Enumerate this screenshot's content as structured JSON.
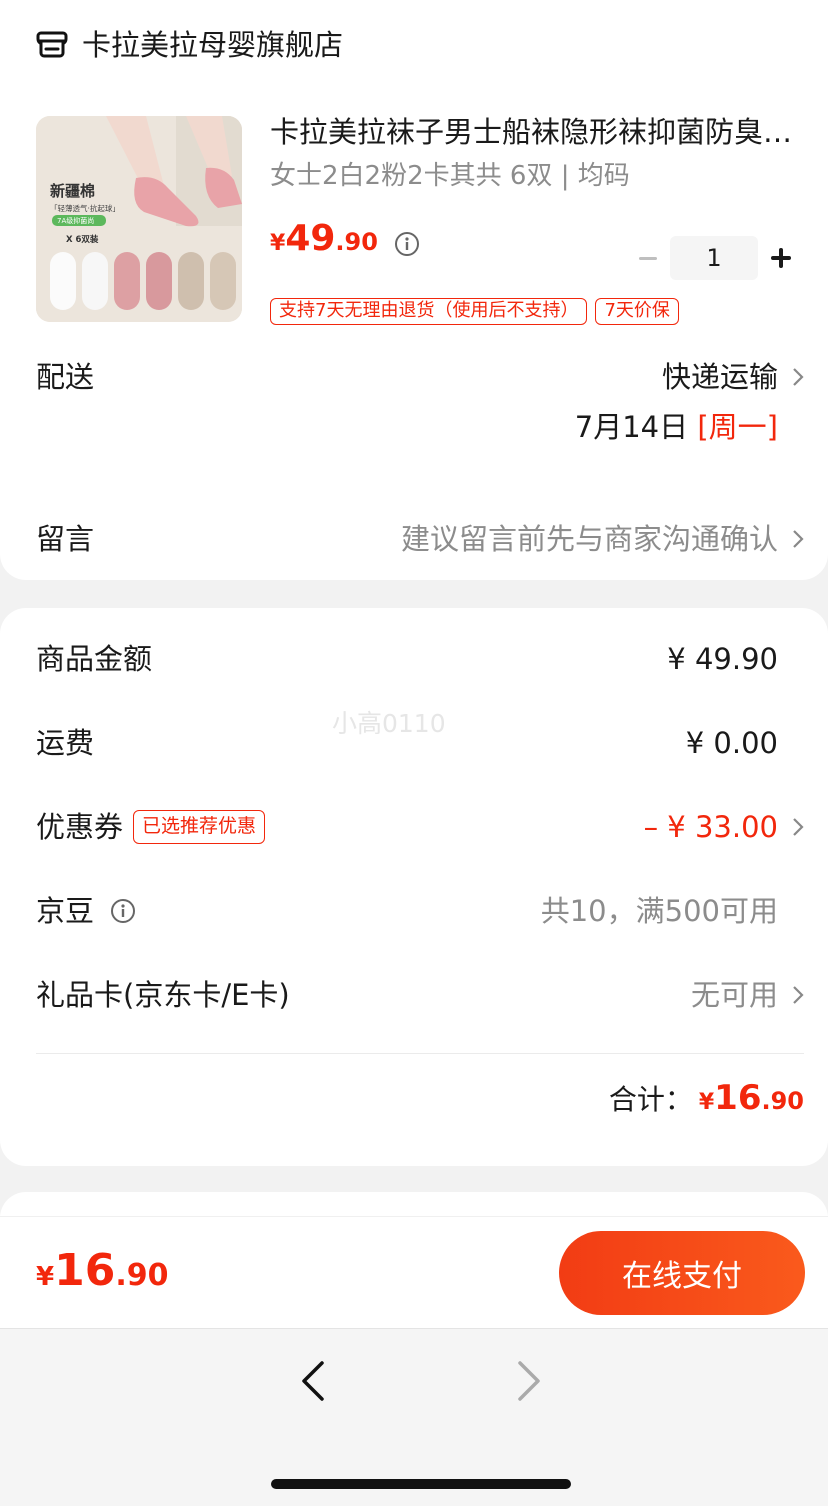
{
  "shop": {
    "name": "卡拉美拉母婴旗舰店",
    "icon": "store-icon"
  },
  "product": {
    "title": "卡拉美拉袜子男士船袜隐形袜抑菌防臭夏季薄款",
    "spec": "女士2白2粉2卡其共 6双 | 均码",
    "price": {
      "yen": "¥",
      "int": "49",
      "dec": ".90"
    },
    "quantity": "1",
    "tags": [
      "支持7天无理由退货（使用后不支持）",
      "7天价保"
    ],
    "image_text": {
      "line1": "新疆棉",
      "line2": "「轻薄透气·抗起球」",
      "line3": "7A级抑菌尚",
      "line4": "X 6双装"
    }
  },
  "delivery": {
    "label": "配送",
    "method": "快递运输",
    "date": "7月14日",
    "weekday": "[周一]"
  },
  "message": {
    "label": "留言",
    "placeholder": "建议留言前先与商家沟通确认"
  },
  "summary": {
    "goods": {
      "label": "商品金额",
      "value": "¥ 49.90"
    },
    "shipping": {
      "label": "运费",
      "value": "¥ 0.00"
    },
    "coupon": {
      "label": "优惠券",
      "badge": "已选推荐优惠",
      "value": "– ¥ 33.00"
    },
    "jingdou": {
      "label": "京豆",
      "value": "共10，满500可用"
    },
    "giftcard": {
      "label": "礼品卡(京东卡/E卡)",
      "value": "无可用"
    },
    "total": {
      "label": "合计：",
      "yen": "¥",
      "int": "16",
      "dec": ".90"
    },
    "watermark": "小高0110"
  },
  "pay_bar": {
    "yen": "¥",
    "int": "16",
    "dec": ".90",
    "button": "在线支付"
  },
  "colors": {
    "accent": "#f2270c",
    "muted": "#8c8c8c"
  }
}
